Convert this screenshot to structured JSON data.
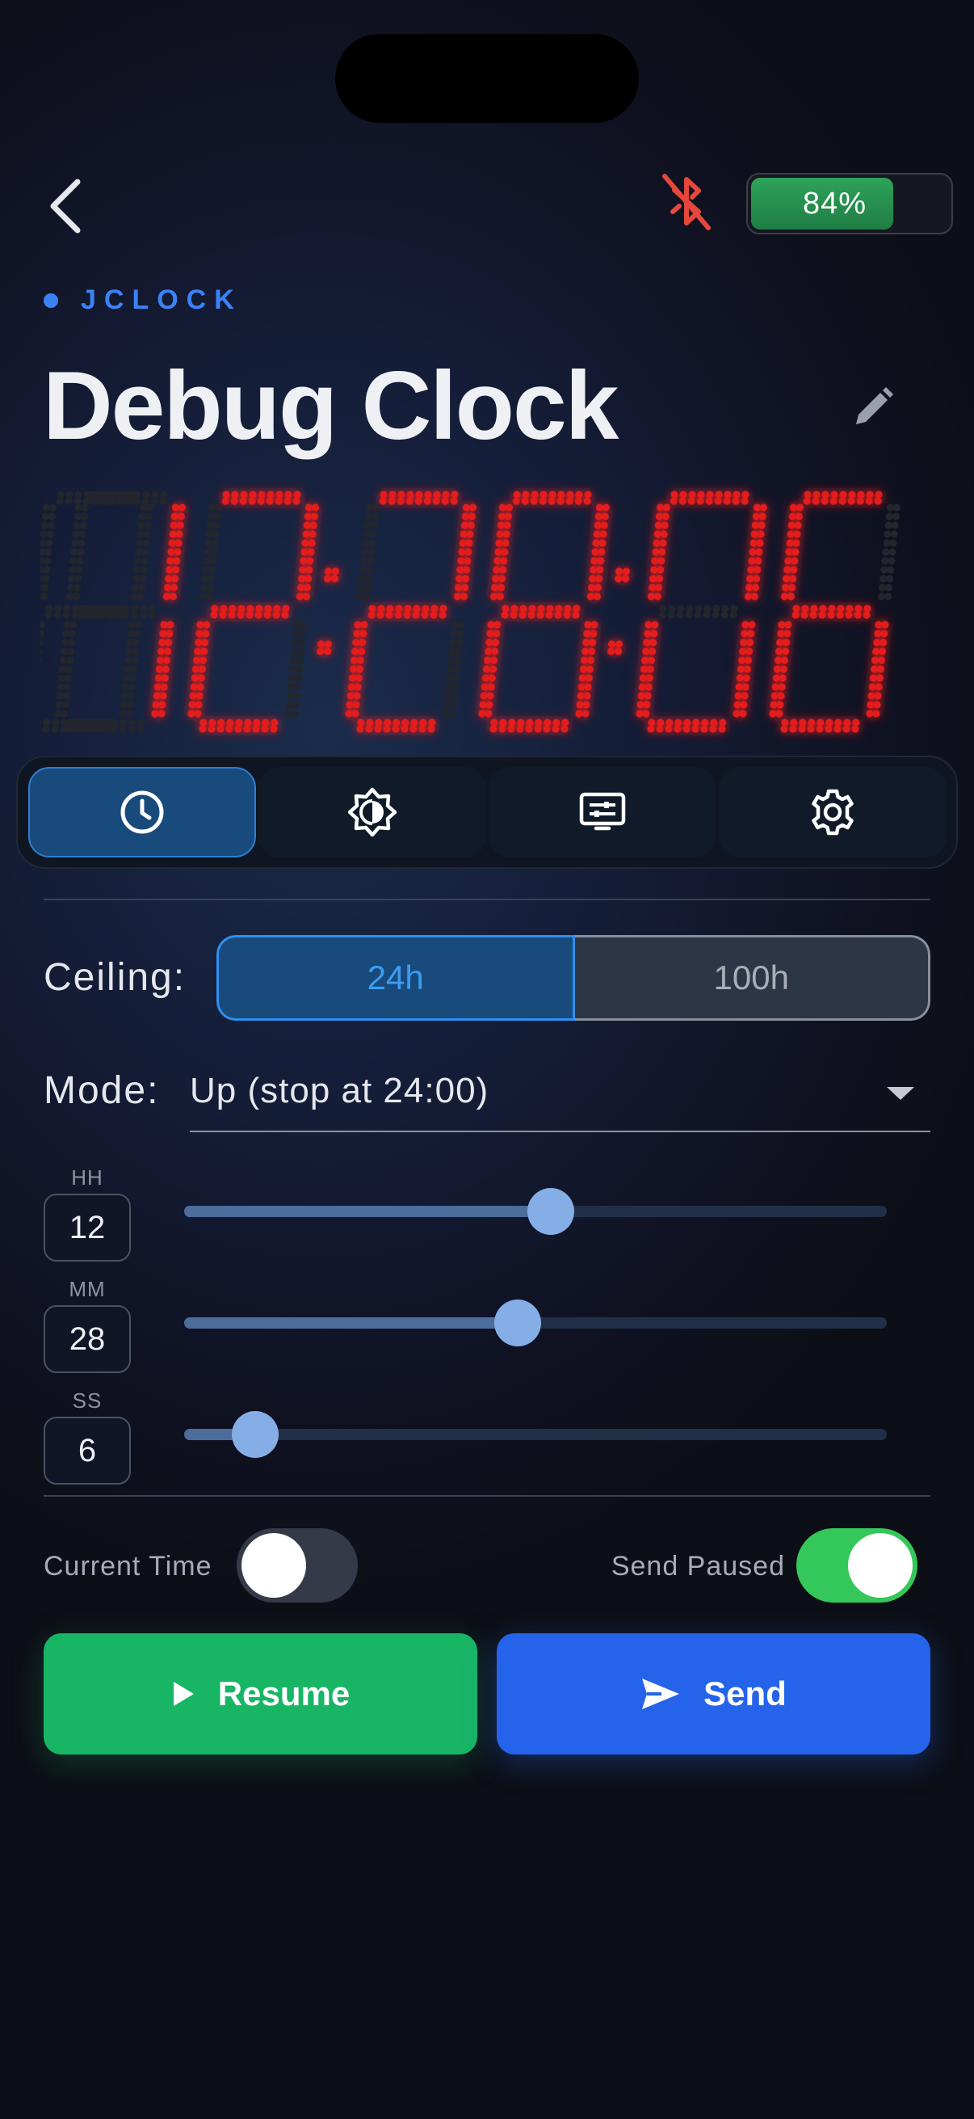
{
  "header": {
    "back_icon": "chevron-left-icon",
    "bluetooth_icon": "bluetooth-off-icon",
    "battery": {
      "level": 0.84,
      "text": "84%"
    }
  },
  "brand": "JCLOCK",
  "title": "Debug Clock",
  "edit_icon": "pencil-icon",
  "display": {
    "time": "12:28:06",
    "color": "#e31d1d"
  },
  "tabs": [
    {
      "icon": "clock-icon",
      "active": true
    },
    {
      "icon": "brightness-icon",
      "active": false
    },
    {
      "icon": "display-settings-icon",
      "active": false
    },
    {
      "icon": "gear-icon",
      "active": false
    }
  ],
  "ceiling": {
    "label": "Ceiling:",
    "options": [
      "24h",
      "100h"
    ],
    "selected": "24h"
  },
  "mode": {
    "label": "Mode:",
    "value": "Up (stop at 24:00)"
  },
  "time_inputs": [
    {
      "unit": "HH",
      "value": "12",
      "min": 0,
      "max": 23
    },
    {
      "unit": "MM",
      "value": "28",
      "min": 0,
      "max": 59
    },
    {
      "unit": "SS",
      "value": "6",
      "min": 0,
      "max": 59
    }
  ],
  "current_time": {
    "label": "Current Time",
    "on": false
  },
  "send_paused": {
    "label": "Send Paused",
    "on": true
  },
  "actions": {
    "resume": {
      "label": "Resume",
      "icon": "play-icon",
      "color": "#18b565"
    },
    "send": {
      "label": "Send",
      "icon": "send-icon",
      "color": "#2563eb"
    }
  },
  "colors": {
    "accent": "#3b82f6",
    "toggle_on": "#34c759",
    "bluetooth_off": "#e5483a"
  }
}
